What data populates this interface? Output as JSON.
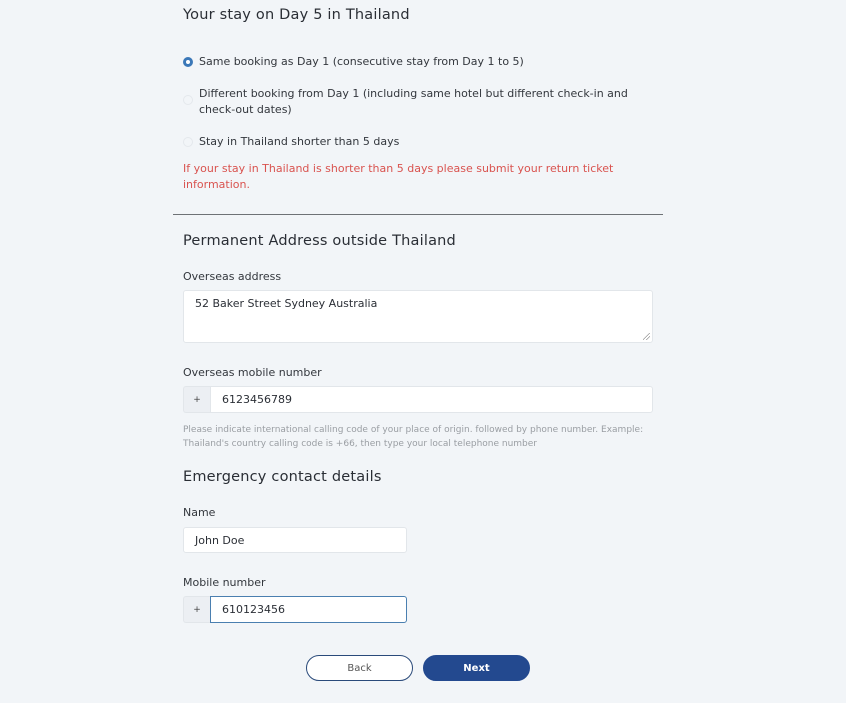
{
  "stay_section": {
    "title": "Your stay on Day 5 in Thailand",
    "options": [
      {
        "label": "Same booking as Day 1 (consecutive stay from Day 1 to 5)",
        "checked": true
      },
      {
        "label": "Different booking from Day 1 (including same hotel but different check-in and check-out dates)",
        "checked": false
      },
      {
        "label": "Stay in Thailand shorter than 5 days",
        "checked": false
      }
    ],
    "warning": "If your stay in Thailand is shorter than 5 days please submit your return ticket information."
  },
  "address_section": {
    "title": "Permanent Address outside Thailand",
    "address_label": "Overseas address",
    "address_value": "52 Baker Street Sydney Australia",
    "mobile_label": "Overseas mobile number",
    "mobile_prefix": "+",
    "mobile_value": "6123456789",
    "mobile_hint": "Please indicate international calling code of your place of origin. followed by phone number. Example: Thailand's country calling code is +66, then type your local telephone number"
  },
  "emergency_section": {
    "title": "Emergency contact details",
    "name_label": "Name",
    "name_value": "John Doe",
    "mobile_label": "Mobile number",
    "mobile_prefix": "+",
    "mobile_value": "610123456"
  },
  "buttons": {
    "back": "Back",
    "next": "Next"
  }
}
